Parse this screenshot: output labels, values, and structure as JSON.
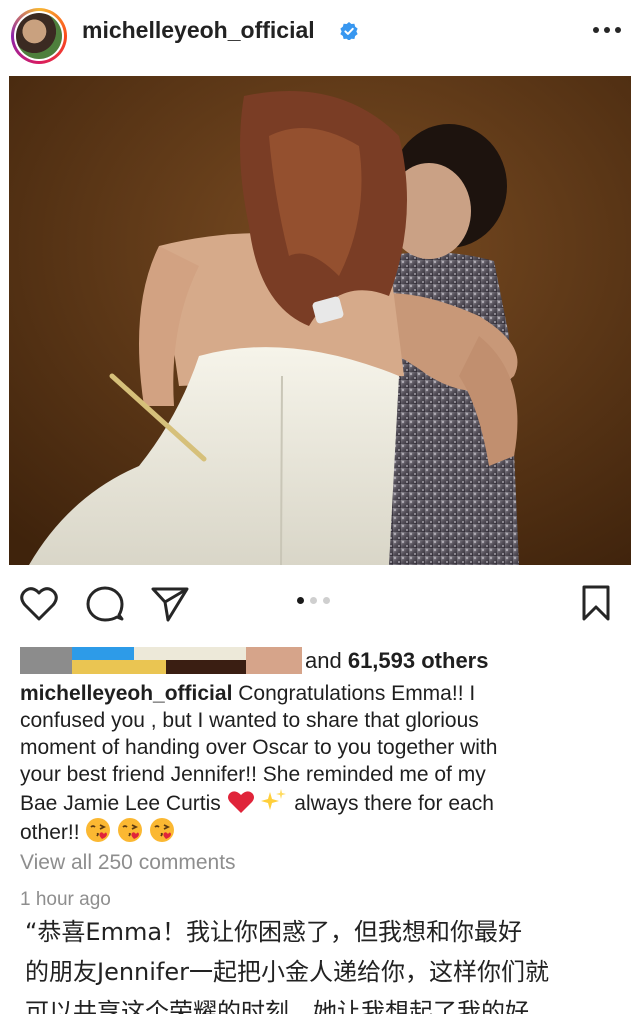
{
  "post": {
    "username": "michelleyeoh_official",
    "verified": true,
    "likes_prefix": "and ",
    "likes_count": "61,593",
    "likes_suffix": " others",
    "caption_user": "michelleyeoh_official",
    "caption_lines": [
      " Congratulations Emma!! I",
      "confused you , but I wanted to share that glorious",
      "moment of handing over Oscar to you together with",
      "your best friend Jennifer!! She reminded me of my",
      "Bae Jamie Lee Curtis",
      " always there for each",
      "other!! "
    ],
    "view_comments": "View all 250 comments",
    "time_ago": "1 hour ago",
    "translation_lines": [
      "“恭喜Emma！我让你困惑了，但我想和你最好",
      "的朋友Jennifer一起把小金人递给你，这样你们就",
      "可以共享这个荣耀的时刻，她让我想起了我的好"
    ],
    "carousel": {
      "count": 3,
      "active_index": 0
    }
  },
  "icons": {
    "verified": "verified-badge-icon",
    "more": "more-options-icon",
    "like": "heart-icon",
    "comment": "comment-icon",
    "share": "send-icon",
    "save": "bookmark-icon",
    "emoji_heart": "red-heart-emoji",
    "emoji_sparkles": "sparkles-emoji",
    "emoji_kiss": "face-blowing-kiss-emoji"
  },
  "colors": {
    "verified_blue": "#3897f0",
    "secondary_text": "#8e8e8e",
    "heart_red": "#e0245e"
  }
}
